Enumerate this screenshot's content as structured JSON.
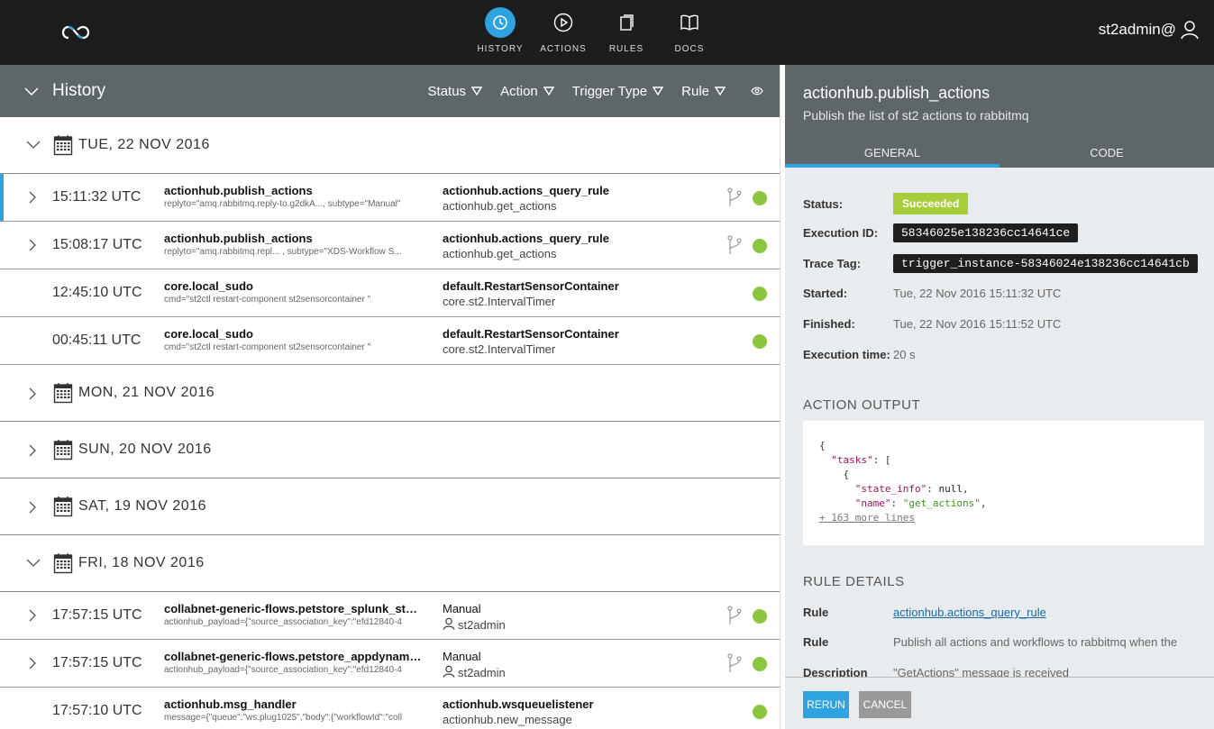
{
  "user": {
    "name": "st2admin@"
  },
  "nav": [
    {
      "label": "HISTORY",
      "icon": "history-icon",
      "active": true
    },
    {
      "label": "ACTIONS",
      "icon": "play-icon",
      "active": false
    },
    {
      "label": "RULES",
      "icon": "rules-icon",
      "active": false
    },
    {
      "label": "DOCS",
      "icon": "book-icon",
      "active": false
    }
  ],
  "history": {
    "title": "History",
    "filters": [
      "Status",
      "Action",
      "Trigger Type",
      "Rule"
    ],
    "groups": [
      {
        "date": "TUE, 22 NOV 2016",
        "expanded": true
      },
      {
        "date": "MON, 21 NOV 2016",
        "expanded": false
      },
      {
        "date": "SUN, 20 NOV 2016",
        "expanded": false
      },
      {
        "date": "SAT, 19 NOV 2016",
        "expanded": false
      },
      {
        "date": "FRI, 18 NOV 2016",
        "expanded": true
      }
    ],
    "rows": [
      {
        "time": "15:11:32 UTC",
        "action": "actionhub.publish_actions",
        "params": "replyto=\"amq.rabbitmq.reply-to.g2dkA..., subtype=\"Manual\"",
        "rule": "actionhub.actions_query_rule",
        "sub": "actionhub.get_actions",
        "workflow": true,
        "expandable": true
      },
      {
        "time": "15:08:17 UTC",
        "action": "actionhub.publish_actions",
        "params": "replyto=\"amq.rabbitmq.repl... , subtype=\"XDS-Workflow S...",
        "rule": "actionhub.actions_query_rule",
        "sub": "actionhub.get_actions",
        "workflow": true,
        "expandable": true
      },
      {
        "time": "12:45:10 UTC",
        "action": "core.local_sudo",
        "params": "cmd=\"st2ctl restart-component st2sensorcontainer \"",
        "rule": "default.RestartSensorContainer",
        "sub": "core.st2.IntervalTimer",
        "workflow": false,
        "expandable": false
      },
      {
        "time": "00:45:11 UTC",
        "action": "core.local_sudo",
        "params": "cmd=\"st2ctl restart-component st2sensorcontainer \"",
        "rule": "default.RestartSensorContainer",
        "sub": "core.st2.IntervalTimer",
        "workflow": false,
        "expandable": false
      },
      {
        "time": "17:57:15 UTC",
        "action": "collabnet-generic-flows.petstore_splunk_start...",
        "params": "actionhub_payload={\"source_association_key\":\"efd12840-4",
        "rule": "Manual",
        "sub": "st2admin",
        "workflow": true,
        "expandable": true
      },
      {
        "time": "17:57:15 UTC",
        "action": "collabnet-generic-flows.petstore_appdynamic...",
        "params": "actionhub_payload={\"source_association_key\":\"efd12840-4",
        "rule": "Manual",
        "sub": "st2admin",
        "workflow": true,
        "expandable": true
      },
      {
        "time": "17:57:10 UTC",
        "action": "actionhub.msg_handler",
        "params": "message={\"queue\":\"ws.plug1025\",\"body\":{\"workflowId\":\"coll",
        "rule": "actionhub.wsqueuelistener",
        "sub": "actionhub.new_message",
        "workflow": false,
        "expandable": false
      }
    ],
    "status_color": "#8cc63f"
  },
  "detail": {
    "title": "actionhub.publish_actions",
    "subtitle": "Publish the list of st2 actions to rabbitmq",
    "tabs": [
      "GENERAL",
      "CODE"
    ],
    "fields": {
      "status_label": "Status:",
      "status": "Succeeded",
      "execution_id_label": "Execution ID:",
      "execution_id": "58346025e138236cc14641ce",
      "trace_tag_label": "Trace Tag:",
      "trace_tag": "trigger_instance-58346024e138236cc14641cb",
      "started_label": "Started:",
      "started": "Tue, 22 Nov 2016 15:11:32 UTC",
      "finished_label": "Finished:",
      "finished": "Tue, 22 Nov 2016 15:11:52 UTC",
      "execution_time_label": "Execution time:",
      "execution_time": "20 s"
    },
    "output_title": "ACTION OUTPUT",
    "output": {
      "line1": "{",
      "key_tasks": "\"tasks\"",
      "open_bracket": ": [",
      "open_brace": "{",
      "key_state": "\"state_info\"",
      "val_state": "null",
      "key_name": "\"name\"",
      "val_name": "\"get_actions\"",
      "more": "+ 163 more lines"
    },
    "rule_title": "RULE DETAILS",
    "rule_label": "Rule",
    "rule_value": "actionhub.actions_query_rule",
    "rule_desc_label": "Rule Description",
    "rule_desc_line1": "Publish all actions and workflows to rabbitmq when the",
    "rule_desc_line2": "\"GetActions\" message is received",
    "buttons": {
      "rerun": "RERUN",
      "cancel": "CANCEL"
    },
    "accent": "#2ea3df",
    "success": "#a8cd3a"
  }
}
